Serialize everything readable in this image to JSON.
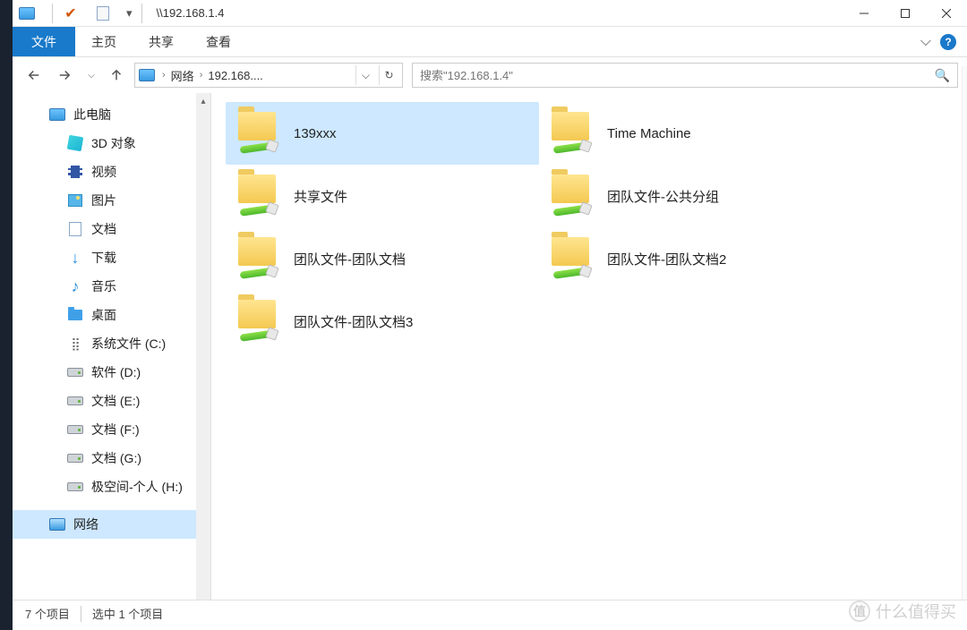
{
  "window": {
    "title": "\\\\192.168.1.4"
  },
  "ribbon": {
    "file": "文件",
    "tabs": [
      "主页",
      "共享",
      "查看"
    ]
  },
  "nav": {
    "crumbs": [
      "网络",
      "192.168...."
    ]
  },
  "search": {
    "placeholder": "搜索\"192.168.1.4\""
  },
  "sidebar": {
    "root": "此电脑",
    "items": [
      "3D 对象",
      "视频",
      "图片",
      "文档",
      "下载",
      "音乐",
      "桌面",
      "系统文件 (C:)",
      "软件 (D:)",
      "文档 (E:)",
      "文档 (F:)",
      "文档 (G:)",
      "极空间-个人 (H:)"
    ],
    "network": "网络"
  },
  "folders": [
    {
      "label": "139xxx",
      "selected": true
    },
    {
      "label": "Time Machine",
      "selected": false
    },
    {
      "label": "共享文件",
      "selected": false
    },
    {
      "label": "团队文件-公共分组",
      "selected": false
    },
    {
      "label": "团队文件-团队文档",
      "selected": false
    },
    {
      "label": "团队文件-团队文档2",
      "selected": false
    },
    {
      "label": "团队文件-团队文档3",
      "selected": false
    }
  ],
  "status": {
    "count": "7 个项目",
    "selected": "选中 1 个项目"
  },
  "watermark": "什么值得买"
}
